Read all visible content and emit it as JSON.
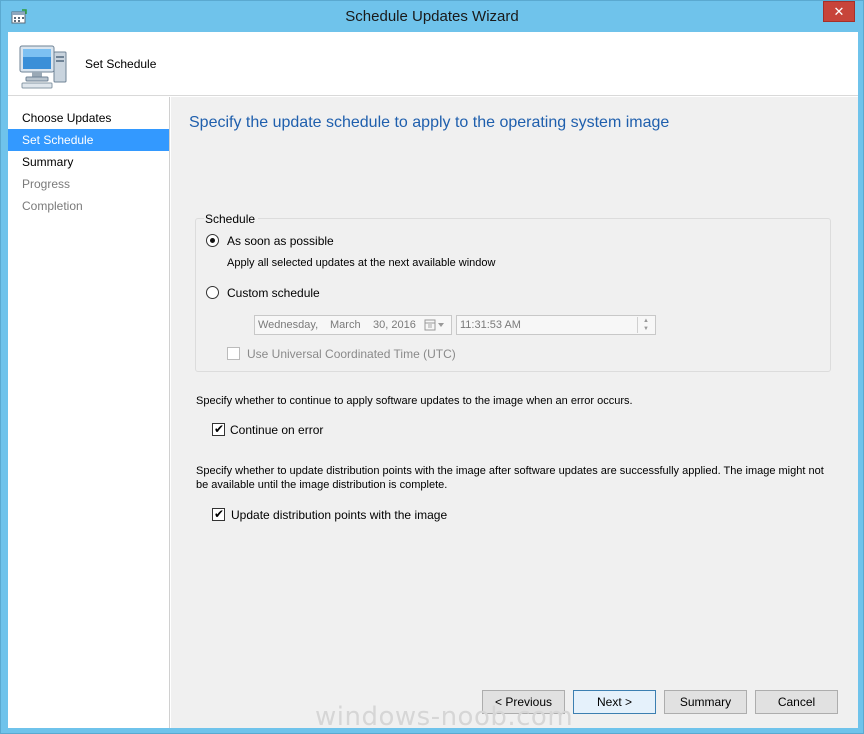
{
  "window": {
    "title": "Schedule Updates Wizard",
    "close_glyph": "✕"
  },
  "header": {
    "title": "Set Schedule",
    "icon": "computer-monitor-icon"
  },
  "nav": {
    "items": [
      {
        "label": "Choose Updates",
        "state": "normal"
      },
      {
        "label": "Set Schedule",
        "state": "active"
      },
      {
        "label": "Summary",
        "state": "normal"
      },
      {
        "label": "Progress",
        "state": "muted"
      },
      {
        "label": "Completion",
        "state": "muted"
      }
    ]
  },
  "page": {
    "heading": "Specify the update schedule to apply to the operating system image"
  },
  "schedule": {
    "legend": "Schedule",
    "asap_label": "As soon as possible",
    "asap_selected": true,
    "asap_description": "Apply all selected updates at the next available window",
    "custom_label": "Custom schedule",
    "custom_selected": false,
    "date": {
      "weekday": "Wednesday,",
      "month": "March",
      "day_year": "30, 2016"
    },
    "time": "11:31:53 AM",
    "utc_label": "Use Universal Coordinated Time (UTC)",
    "utc_checked": false
  },
  "error_section": {
    "description": "Specify whether to continue to apply software updates to the image when an error occurs.",
    "checkbox_label": "Continue on error",
    "checked": true
  },
  "distribution_section": {
    "description": "Specify whether to update distribution points with the image after software updates are successfully applied. The image might not be available until the image distribution is complete.",
    "checkbox_label": "Update distribution points with the image",
    "checked": true
  },
  "buttons": {
    "previous": "< Previous",
    "next": "Next >",
    "summary": "Summary",
    "cancel": "Cancel"
  },
  "watermark": "windows-noob.com",
  "colors": {
    "title_bar": "#6fc3eb",
    "close_button": "#c7443a",
    "nav_active": "#3399ff",
    "heading_text": "#1f5fad",
    "content_background": "#f0f0f0"
  }
}
